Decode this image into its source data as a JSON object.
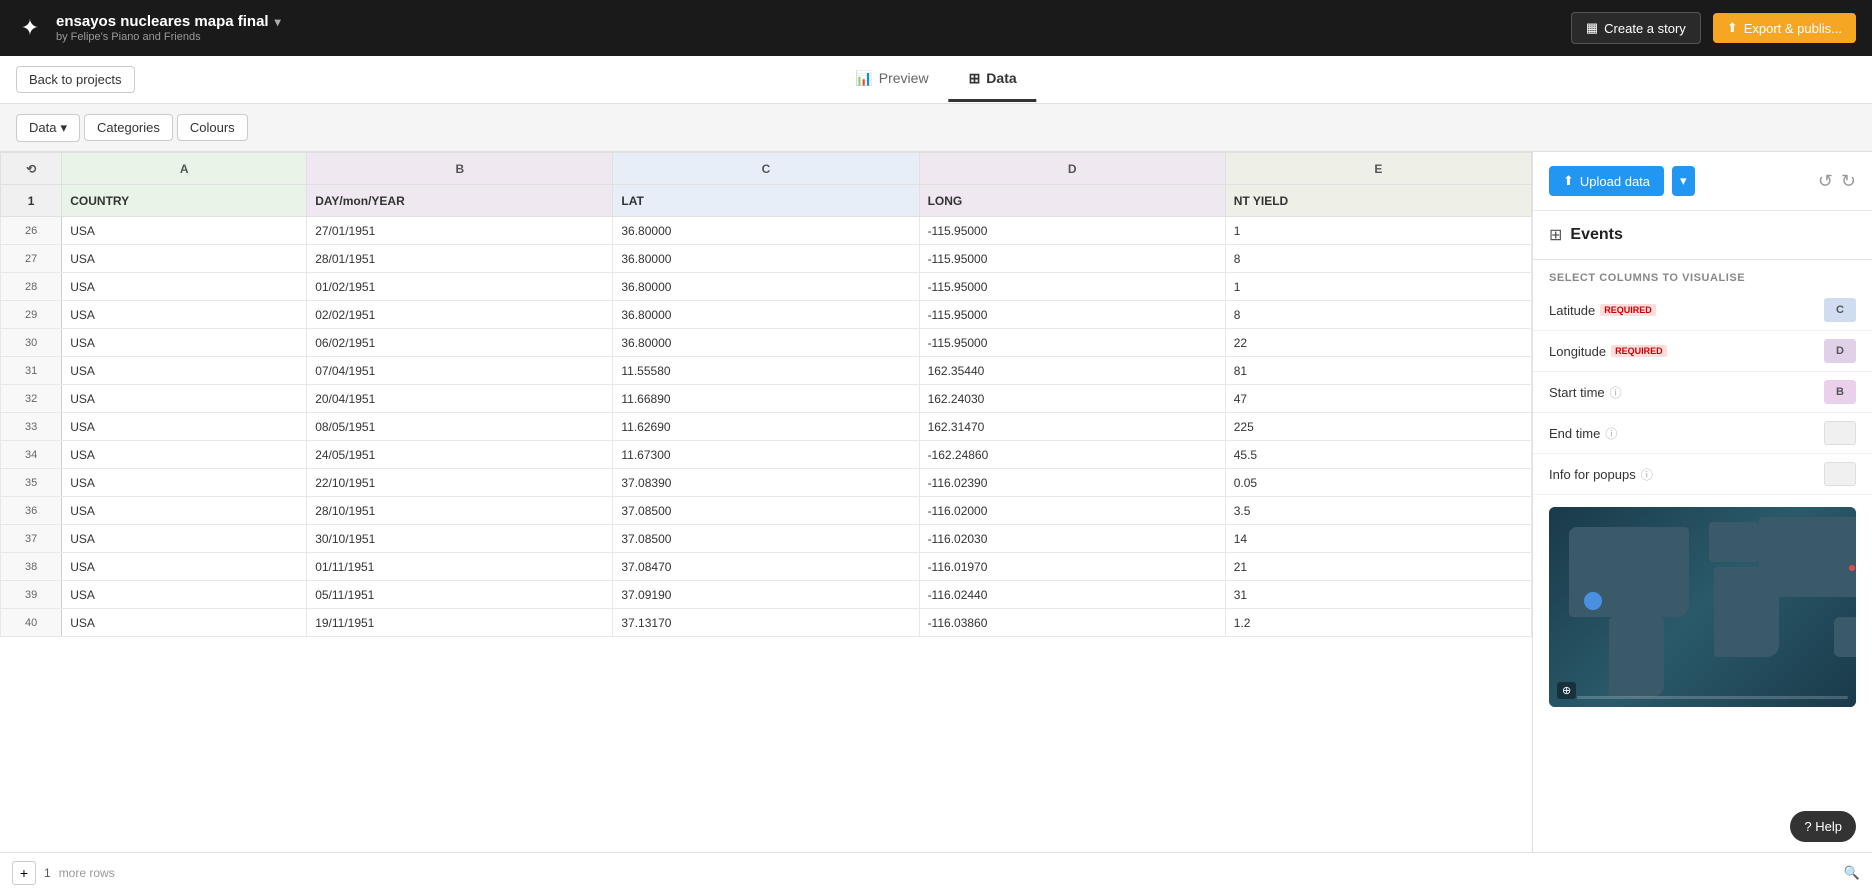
{
  "app": {
    "logo": "✦",
    "project_title": "ensayos nucleares mapa final",
    "project_subtitle": "by Felipe's Piano and Friends",
    "chevron": "▾"
  },
  "topnav": {
    "create_story_label": "Create a story",
    "export_label": "Export & publis..."
  },
  "subnav": {
    "back_label": "Back to projects",
    "tabs": [
      {
        "id": "preview",
        "label": "Preview",
        "active": false
      },
      {
        "id": "data",
        "label": "Data",
        "active": true
      }
    ]
  },
  "toolbar": {
    "data_label": "Data",
    "categories_label": "Categories",
    "colours_label": "Colours"
  },
  "table": {
    "columns": [
      {
        "id": "A",
        "label": "A",
        "field": "COUNTRY"
      },
      {
        "id": "B",
        "label": "B",
        "field": "DAY/mon/YEAR"
      },
      {
        "id": "C",
        "label": "C",
        "field": "LAT"
      },
      {
        "id": "D",
        "label": "D",
        "field": "LONG"
      },
      {
        "id": "E",
        "label": "E",
        "field": "NT YIELD"
      }
    ],
    "rows": [
      {
        "num": 1,
        "country": "COUNTRY",
        "date": "DAY/mon/YEAR",
        "lat": "LAT",
        "long": "LONG",
        "yield": "NT YIELD"
      },
      {
        "num": 26,
        "country": "USA",
        "date": "27/01/1951",
        "lat": "36.80000",
        "long": "-115.95000",
        "yield": "1"
      },
      {
        "num": 27,
        "country": "USA",
        "date": "28/01/1951",
        "lat": "36.80000",
        "long": "-115.95000",
        "yield": "8"
      },
      {
        "num": 28,
        "country": "USA",
        "date": "01/02/1951",
        "lat": "36.80000",
        "long": "-115.95000",
        "yield": "1"
      },
      {
        "num": 29,
        "country": "USA",
        "date": "02/02/1951",
        "lat": "36.80000",
        "long": "-115.95000",
        "yield": "8"
      },
      {
        "num": 30,
        "country": "USA",
        "date": "06/02/1951",
        "lat": "36.80000",
        "long": "-115.95000",
        "yield": "22"
      },
      {
        "num": 31,
        "country": "USA",
        "date": "07/04/1951",
        "lat": "11.55580",
        "long": "162.35440",
        "yield": "81"
      },
      {
        "num": 32,
        "country": "USA",
        "date": "20/04/1951",
        "lat": "11.66890",
        "long": "162.24030",
        "yield": "47"
      },
      {
        "num": 33,
        "country": "USA",
        "date": "08/05/1951",
        "lat": "11.62690",
        "long": "162.31470",
        "yield": "225"
      },
      {
        "num": 34,
        "country": "USA",
        "date": "24/05/1951",
        "lat": "11.67300",
        "long": "-162.24860",
        "yield": "45.5"
      },
      {
        "num": 35,
        "country": "USA",
        "date": "22/10/1951",
        "lat": "37.08390",
        "long": "-116.02390",
        "yield": "0.05"
      },
      {
        "num": 36,
        "country": "USA",
        "date": "28/10/1951",
        "lat": "37.08500",
        "long": "-116.02000",
        "yield": "3.5"
      },
      {
        "num": 37,
        "country": "USA",
        "date": "30/10/1951",
        "lat": "37.08500",
        "long": "-116.02030",
        "yield": "14"
      },
      {
        "num": 38,
        "country": "USA",
        "date": "01/11/1951",
        "lat": "37.08470",
        "long": "-116.01970",
        "yield": "21"
      },
      {
        "num": 39,
        "country": "USA",
        "date": "05/11/1951",
        "lat": "37.09190",
        "long": "-116.02440",
        "yield": "31"
      },
      {
        "num": 40,
        "country": "USA",
        "date": "19/11/1951",
        "lat": "37.13170",
        "long": "-116.03860",
        "yield": "1.2"
      }
    ]
  },
  "right_panel": {
    "title": "Events",
    "upload_label": "Upload data",
    "select_columns_label": "SELECT COLUMNS TO VISUALISE",
    "fields": [
      {
        "id": "latitude",
        "label": "Latitude",
        "required": true,
        "col": "C",
        "badge_class": "col-badge-c"
      },
      {
        "id": "longitude",
        "label": "Longitude",
        "required": true,
        "col": "D",
        "badge_class": "col-badge-d"
      },
      {
        "id": "start_time",
        "label": "Start time",
        "info": true,
        "col": "B",
        "badge_class": "col-badge-b"
      },
      {
        "id": "end_time",
        "label": "End time",
        "info": true,
        "col": "",
        "badge_class": "col-badge-empty"
      },
      {
        "id": "info_popups",
        "label": "Info for popups",
        "info": true,
        "col": "",
        "badge_class": "col-badge-empty"
      }
    ],
    "undo": "↺",
    "redo": "↻"
  },
  "bottom_bar": {
    "add_icon": "+",
    "page_num": "1",
    "more_rows": "more rows",
    "search_icon": "🔍"
  },
  "help": {
    "label": "? Help"
  }
}
